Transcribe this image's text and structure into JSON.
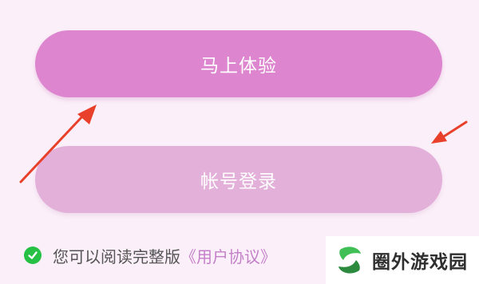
{
  "buttons": {
    "primary_label": "马上体验",
    "secondary_label": "帐号登录"
  },
  "agreement": {
    "text": "您可以阅读完整版",
    "link": "《用户协议》"
  },
  "watermark": {
    "text": "圈外游戏园"
  },
  "colors": {
    "background": "#fbf0f9",
    "primary_button": "#dd85cf",
    "secondary_button": "#e3b0da",
    "check": "#26c144",
    "link": "#c47fc9",
    "arrow": "#e8402a"
  }
}
